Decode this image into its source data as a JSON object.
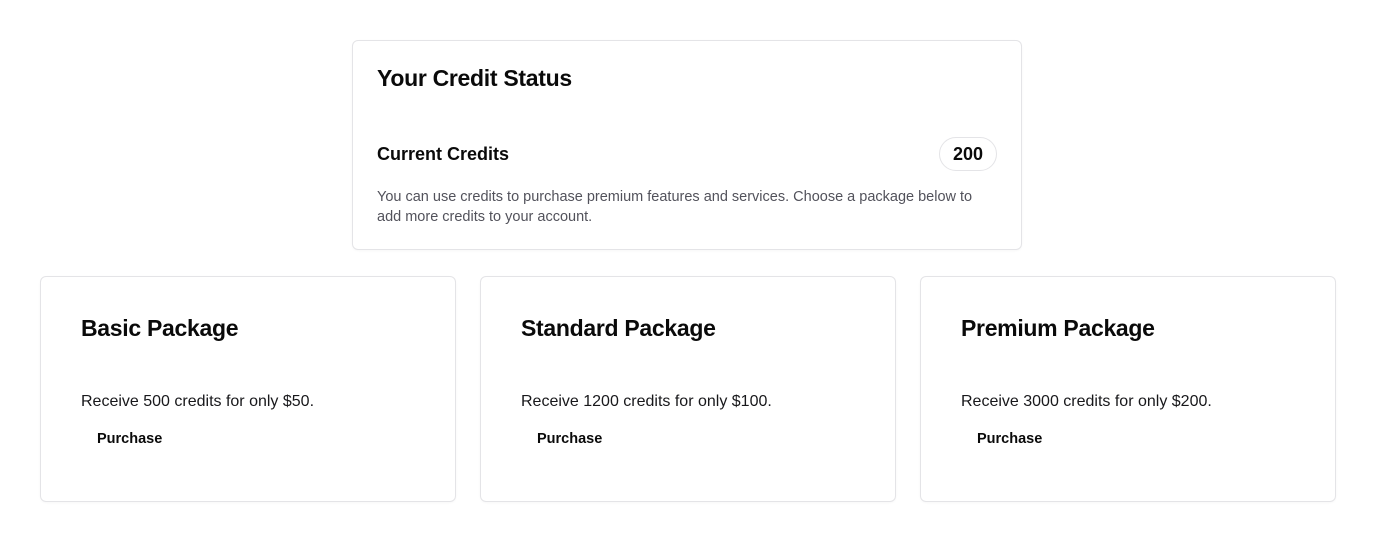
{
  "credit_status": {
    "title": "Your Credit Status",
    "current_credits_label": "Current Credits",
    "current_credits_value": "200",
    "description": "You can use credits to purchase premium features and services. Choose a package below to add more credits to your account."
  },
  "packages": [
    {
      "title": "Basic Package",
      "description": "Receive 500 credits for only $50.",
      "button_label": "Purchase"
    },
    {
      "title": "Standard Package",
      "description": "Receive 1200 credits for only $100.",
      "button_label": "Purchase"
    },
    {
      "title": "Premium Package",
      "description": "Receive 3000 credits for only $200.",
      "button_label": "Purchase"
    }
  ],
  "colors": {
    "border": "#e4e4e7",
    "text_primary": "#0a0a0a",
    "text_muted": "#52525b",
    "background": "#ffffff"
  }
}
